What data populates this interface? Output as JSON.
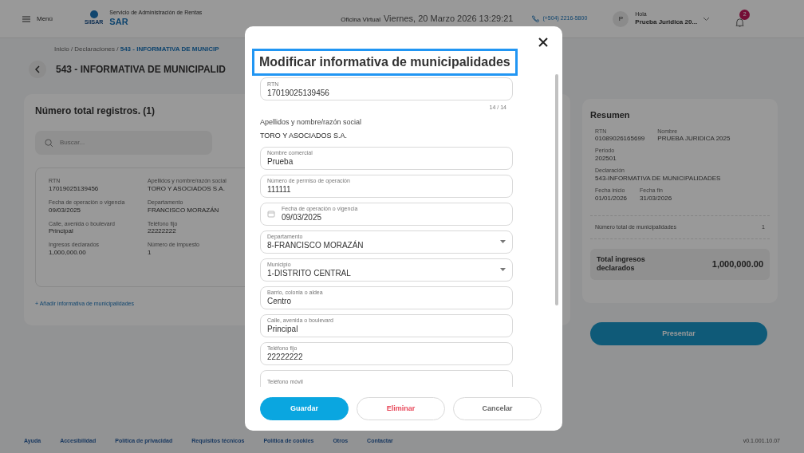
{
  "header": {
    "menu_label": "Menú",
    "logo_text": "SIISAR",
    "org_subtitle": "Servicio de Administración de Rentas",
    "brand": "SAR",
    "office": "Oficina Virtual",
    "datetime": "Viernes, 20 Marzo 2026 13:29:21",
    "phone": "(+504) 2216-5800",
    "avatar_initial": "P",
    "greeting": "Hola",
    "user": "Prueba Juridica 20...",
    "notifications": "2"
  },
  "breadcrumb": {
    "trail": "Inicio / Declaraciones / ",
    "current": "543 - INFORMATIVA DE MUNICIP"
  },
  "page_title": "543 - INFORMATIVA DE MUNICIPALID",
  "records": {
    "title": "Número total registros. (1)",
    "search_placeholder": "Buscar...",
    "fields": [
      {
        "label": "RTN",
        "value": "17019025139456"
      },
      {
        "label": "Apellidos y nombre/razón social",
        "value": "TORO Y ASOCIADOS S.A."
      },
      {
        "label": "Fecha de operación o vigencia",
        "value": "09/03/2025"
      },
      {
        "label": "Departamento",
        "value": "FRANCISCO MORAZÁN"
      },
      {
        "label": "Calle, avenida o boulevard",
        "value": "Principal"
      },
      {
        "label": "Teléfono fijo",
        "value": "22222222"
      },
      {
        "label": "Ingresos declarados",
        "value": "1,000,000.00"
      },
      {
        "label": "Número de impuesto",
        "value": "1"
      }
    ],
    "add_link": "+ Añadir informativa de municipalidades"
  },
  "summary": {
    "title": "Resumen",
    "rows": [
      [
        {
          "label": "RTN",
          "value": "01089026165699"
        },
        {
          "label": "Nombre",
          "value": "PRUEBA JURIDICA 2025"
        }
      ],
      [
        {
          "label": "Periodo",
          "value": "202501"
        }
      ],
      [
        {
          "label": "Declaración",
          "value": "543-INFORMATIVA DE MUNICIPALIDADES"
        }
      ],
      [
        {
          "label": "Fecha inicio",
          "value": "01/01/2026"
        },
        {
          "label": "Fecha fin",
          "value": "31/03/2026"
        }
      ]
    ],
    "count_label": "Número total de municipalidades",
    "count": "1",
    "total_label": "Total ingresos declarados",
    "total": "1,000,000.00"
  },
  "present_button": "Presentar",
  "footer": {
    "links": [
      "Ayuda",
      "Accesibilidad",
      "Política de privacidad",
      "Requisitos técnicos",
      "Política de cookies",
      "Otros",
      "Contactar"
    ],
    "version": "v0.1.001.10.07"
  },
  "modal": {
    "title": "Modificar informativa de municipalidades",
    "fields": [
      {
        "kind": "text",
        "label": "RTN",
        "value": "17019025139456",
        "counter": "14 / 14"
      },
      {
        "kind": "static",
        "label": "Apellidos y nombre/razón social",
        "value": "TORO Y ASOCIADOS S.A."
      },
      {
        "kind": "text",
        "label": "Nombre comercial",
        "value": "Prueba"
      },
      {
        "kind": "text",
        "label": "Número de permiso de operación",
        "value": "111111"
      },
      {
        "kind": "date",
        "label": "Fecha de operación o vigencia",
        "value": "09/03/2025"
      },
      {
        "kind": "select",
        "label": "Departamento",
        "value": "8-FRANCISCO MORAZÁN"
      },
      {
        "kind": "select",
        "label": "Municipio",
        "value": "1-DISTRITO CENTRAL"
      },
      {
        "kind": "text",
        "label": "Barrio, colonia o aldea",
        "value": "Centro"
      },
      {
        "kind": "text",
        "label": "Calle, avenida o boulevard",
        "value": "Principal"
      },
      {
        "kind": "text",
        "label": "Teléfono fijo",
        "value": "22222222"
      },
      {
        "kind": "text",
        "label": "Teléfono móvil"
      }
    ],
    "buttons": [
      {
        "kind": "primary",
        "label": "Guardar"
      },
      {
        "kind": "danger",
        "label": "Eliminar"
      },
      {
        "kind": "secondary",
        "label": "Cancelar"
      }
    ]
  }
}
